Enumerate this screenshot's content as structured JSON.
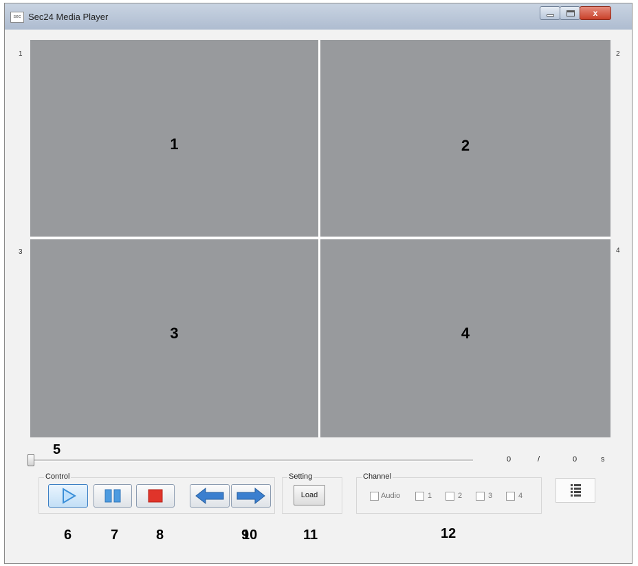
{
  "window": {
    "title": "Sec24 Media Player",
    "app_icon_text": "sec",
    "close_glyph": "x"
  },
  "corner_numbers": [
    "1",
    "2",
    "3",
    "4"
  ],
  "panes": [
    {
      "label": "1"
    },
    {
      "label": "2"
    },
    {
      "label": "3"
    },
    {
      "label": "4"
    }
  ],
  "seek": {
    "position_fraction": 0.0,
    "current": "0",
    "separator": "/",
    "total": "0",
    "unit": "s"
  },
  "control": {
    "title": "Control",
    "buttons": {
      "play": {
        "icon": "play-icon",
        "color": "#3b8fd8"
      },
      "pause": {
        "icon": "pause-icon",
        "color": "#3b8fd8"
      },
      "stop": {
        "icon": "stop-icon",
        "color": "#e0342a"
      },
      "prev": {
        "icon": "arrow-left-icon",
        "color": "#3b7fcf"
      },
      "next": {
        "icon": "arrow-right-icon",
        "color": "#3b7fcf"
      }
    }
  },
  "setting": {
    "title": "Setting",
    "load_label": "Load"
  },
  "channel": {
    "title": "Channel",
    "options": [
      {
        "label": "Audio",
        "checked": false
      },
      {
        "label": "1",
        "checked": false
      },
      {
        "label": "2",
        "checked": false
      },
      {
        "label": "3",
        "checked": false
      },
      {
        "label": "4",
        "checked": false
      }
    ]
  },
  "list_button": {
    "icon": "list-icon"
  },
  "annotations": {
    "a5": "5",
    "a6": "6",
    "a7": "7",
    "a8": "8",
    "a9": "9",
    "a10": "10",
    "a11": "11",
    "a12": "12"
  }
}
